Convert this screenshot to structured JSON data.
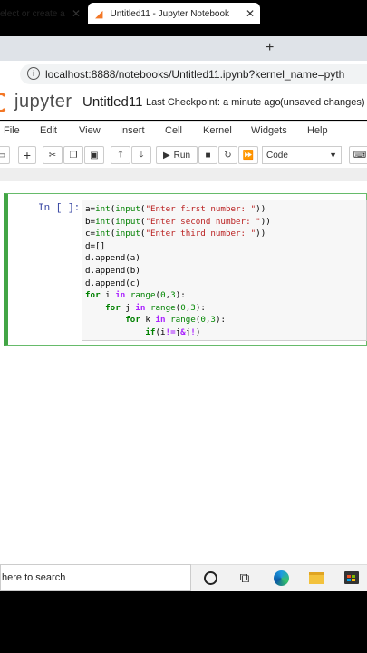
{
  "browser": {
    "tabs": [
      {
        "label": "elect or create a"
      },
      {
        "label": "Untitled11 - Jupyter Notebook"
      }
    ],
    "address": "localhost:8888/notebooks/Untitled11.ipynb?kernel_name=pyth"
  },
  "jupyter": {
    "logo_text": "jupyter",
    "notebook_title": "Untitled11",
    "checkpoint": "Last Checkpoint: a minute ago",
    "autosave_status": "(unsaved changes)",
    "menu": [
      "File",
      "Edit",
      "View",
      "Insert",
      "Cell",
      "Kernel",
      "Widgets",
      "Help"
    ],
    "toolbar": {
      "run_label": "Run",
      "cell_type": "Code"
    },
    "cell": {
      "prompt": "In [ ]:"
    }
  },
  "taskbar": {
    "search_text": "here to search"
  },
  "colors": {
    "jupyter_orange": "#f37726",
    "cell_selected_border": "#42a545",
    "tab_active": "#ffffff",
    "tab_strip": "#dfe3e8"
  }
}
